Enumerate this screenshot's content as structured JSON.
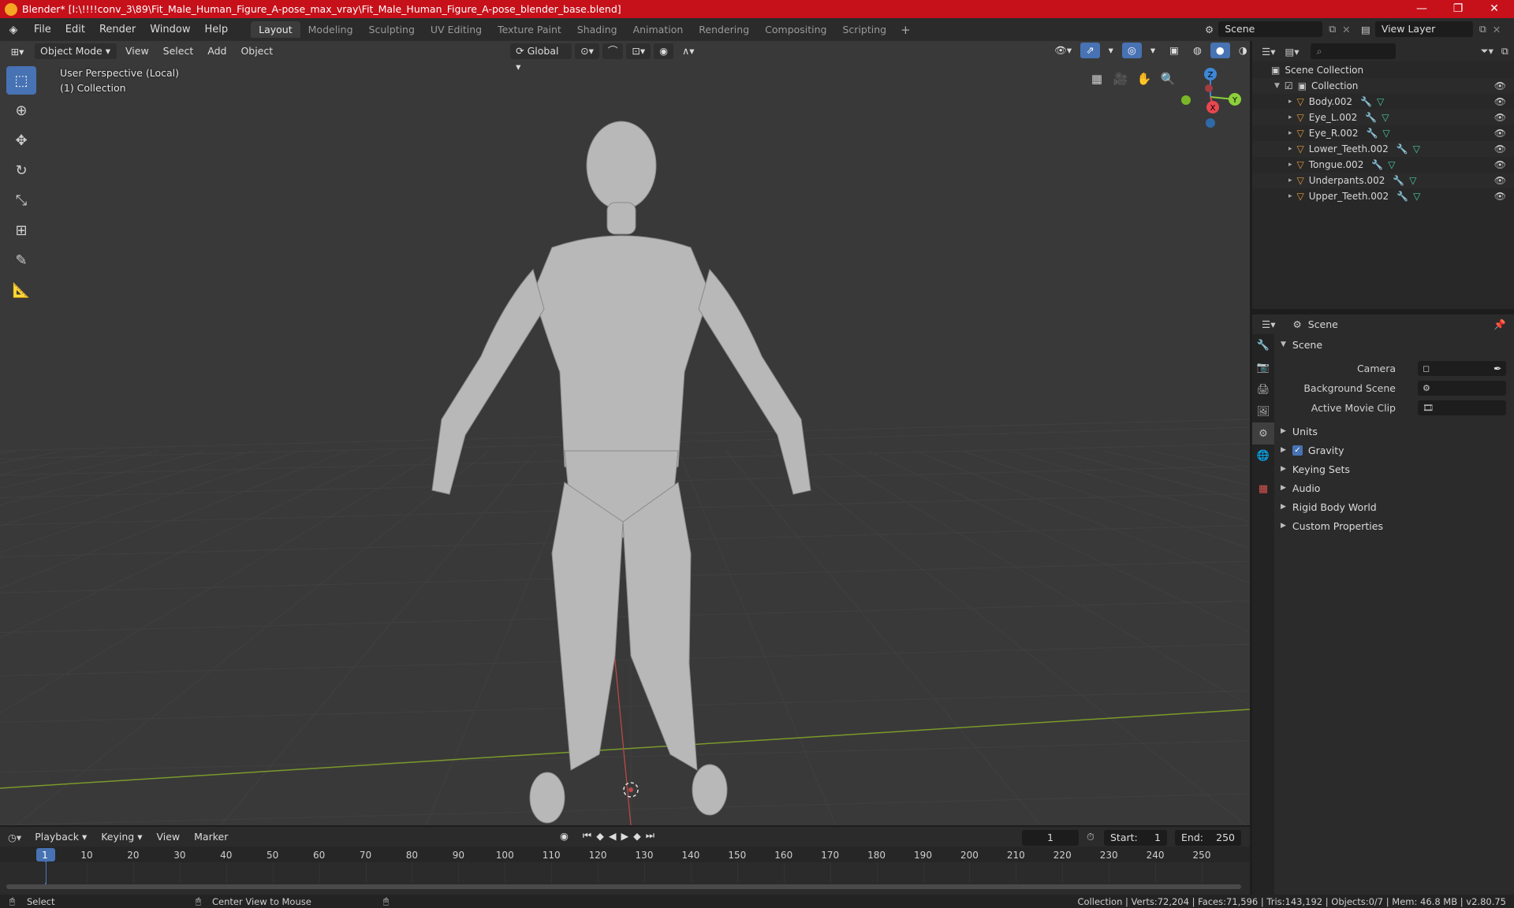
{
  "window": {
    "title": "Blender* [I:\\!!!!conv_3\\89\\Fit_Male_Human_Figure_A-pose_max_vray\\Fit_Male_Human_Figure_A-pose_blender_base.blend]",
    "controls": [
      "—",
      "❐",
      "✕"
    ]
  },
  "menu": [
    "File",
    "Edit",
    "Render",
    "Window",
    "Help"
  ],
  "workspaces": [
    "Layout",
    "Modeling",
    "Sculpting",
    "UV Editing",
    "Texture Paint",
    "Shading",
    "Animation",
    "Rendering",
    "Compositing",
    "Scripting"
  ],
  "scene_field": "Scene",
  "view_layer_field": "View Layer",
  "viewport": {
    "mode": "Object Mode",
    "menus": [
      "View",
      "Select",
      "Add",
      "Object"
    ],
    "orientation": "Global",
    "perspective_label": "User Perspective (Local)",
    "collection_label": "(1) Collection",
    "gizmo": {
      "z": "Z",
      "y": "Y",
      "x": "X"
    }
  },
  "outliner": {
    "root": "Scene Collection",
    "collection": "Collection",
    "items": [
      "Body.002",
      "Eye_L.002",
      "Eye_R.002",
      "Lower_Teeth.002",
      "Tongue.002",
      "Underpants.002",
      "Upper_Teeth.002"
    ]
  },
  "properties": {
    "header": "Scene",
    "panel": "Scene",
    "fields": {
      "camera": "Camera",
      "background_scene": "Background Scene",
      "active_movie_clip": "Active Movie Clip"
    },
    "sections": [
      "Units",
      "Gravity",
      "Keying Sets",
      "Audio",
      "Rigid Body World",
      "Custom Properties"
    ],
    "gravity_checked": true
  },
  "timeline": {
    "menus": [
      "Playback",
      "Keying",
      "View",
      "Marker"
    ],
    "current_frame": "1",
    "start_label": "Start:",
    "start": "1",
    "end_label": "End:",
    "end": "250",
    "ticks": [
      "1",
      "10",
      "20",
      "30",
      "40",
      "50",
      "60",
      "70",
      "80",
      "90",
      "100",
      "110",
      "120",
      "130",
      "140",
      "150",
      "160",
      "170",
      "180",
      "190",
      "200",
      "210",
      "220",
      "230",
      "240",
      "250"
    ]
  },
  "status": {
    "left": "Select",
    "middle": "Center View to Mouse",
    "right": "Collection | Verts:72,204 | Faces:71,596 | Tris:143,192 | Objects:0/7 | Mem: 46.8 MB | v2.80.75"
  },
  "colors": {
    "accent": "#4772b3",
    "titlebar": "#c6101a",
    "mesh": "#e39b3a",
    "x_axis": "#e8474f",
    "y_axis": "#8ccf3a",
    "z_axis": "#3e87d7"
  }
}
